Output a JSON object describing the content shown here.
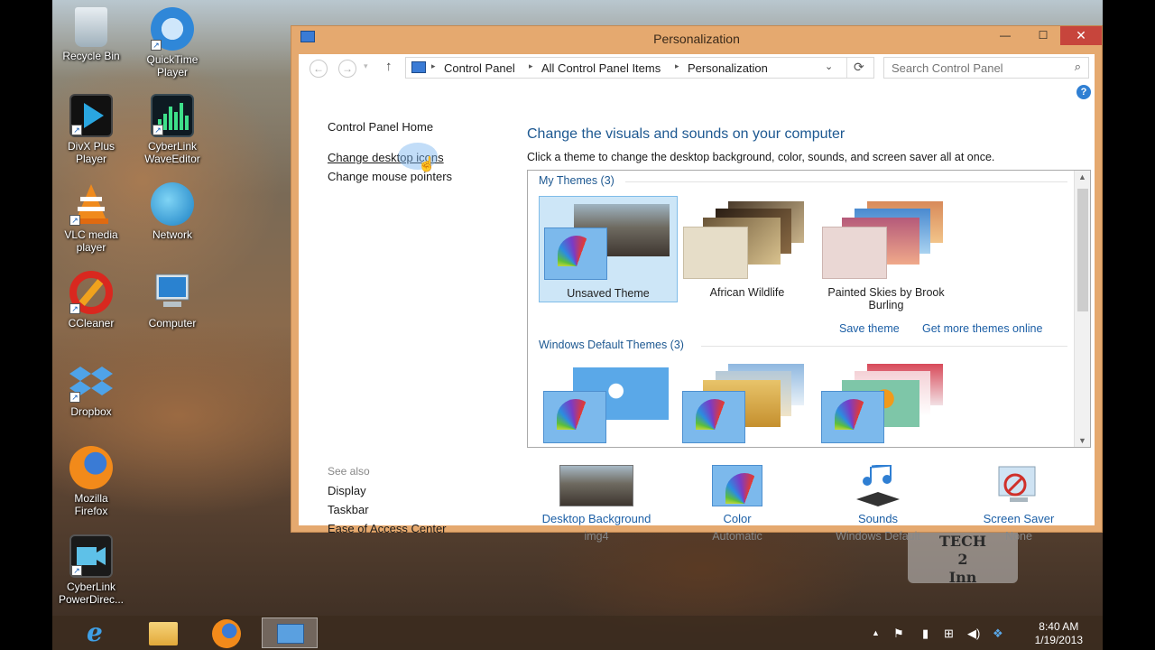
{
  "desktop": {
    "icons": [
      {
        "label": "Recycle Bin"
      },
      {
        "label": "QuickTime Player"
      },
      {
        "label": "DivX Plus Player"
      },
      {
        "label": "CyberLink WaveEditor"
      },
      {
        "label": "VLC media player"
      },
      {
        "label": "Network"
      },
      {
        "label": "CCleaner"
      },
      {
        "label": "Computer"
      },
      {
        "label": "Dropbox"
      },
      {
        "label": "Mozilla Firefox"
      },
      {
        "label": "CyberLink PowerDirec..."
      }
    ]
  },
  "window": {
    "title": "Personalization",
    "minimize_glyph": "—",
    "maximize_glyph": "☐",
    "close_glyph": "✕",
    "breadcrumb": [
      "Control Panel",
      "All Control Panel Items",
      "Personalization"
    ],
    "search_placeholder": "Search Control Panel",
    "help_glyph": "?"
  },
  "sidebar": {
    "home": "Control Panel Home",
    "links": [
      "Change desktop icons",
      "Change mouse pointers"
    ],
    "see_also_title": "See also",
    "see_also": [
      "Display",
      "Taskbar",
      "Ease of Access Center"
    ]
  },
  "main": {
    "heading": "Change the visuals and sounds on your computer",
    "description": "Click a theme to change the desktop background, color, sounds, and screen saver all at once.",
    "my_themes_title": "My Themes (3)",
    "my_themes": [
      {
        "name": "Unsaved Theme"
      },
      {
        "name": "African Wildlife"
      },
      {
        "name": "Painted Skies by Brook Burling"
      }
    ],
    "save_theme": "Save theme",
    "get_more": "Get more themes online",
    "default_themes_title": "Windows Default Themes (3)"
  },
  "bottom": [
    {
      "label": "Desktop Background",
      "value": "img4"
    },
    {
      "label": "Color",
      "value": "Automatic"
    },
    {
      "label": "Sounds",
      "value": "Windows Default"
    },
    {
      "label": "Screen Saver",
      "value": "None"
    }
  ],
  "taskbar": {
    "time": "8:40 AM",
    "date": "1/19/2013"
  },
  "watermark": {
    "line1": "TECH",
    "line2": "2",
    "line3": "Inn"
  },
  "colors": {
    "accent_link": "#1c5fa6",
    "window_border": "#e5a96f",
    "close_button": "#c7453c",
    "selected_theme": "#cde6f7"
  }
}
